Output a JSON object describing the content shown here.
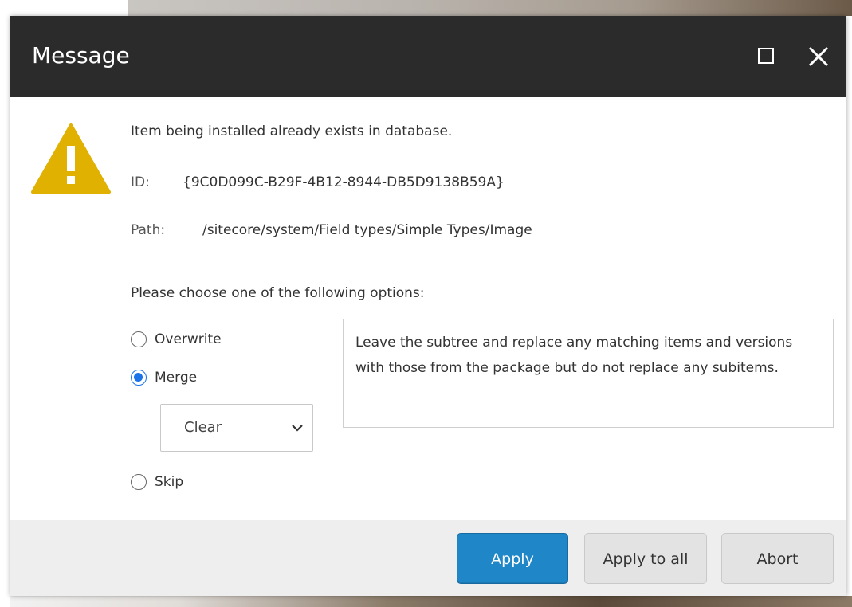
{
  "dialog": {
    "title": "Message",
    "maximize_icon": "maximize-icon",
    "close_icon": "close-icon"
  },
  "content": {
    "warning_icon": "warning-triangle-icon",
    "message": "Item being installed already exists in database.",
    "id_label": "ID:",
    "id_value": "{9C0D099C-B29F-4B12-8944-DB5D9138B59A}",
    "path_label": "Path:",
    "path_value": "/sitecore/system/Field types/Simple Types/Image",
    "prompt": "Please choose one of the following options:"
  },
  "options": {
    "overwrite": "Overwrite",
    "merge": "Merge",
    "skip": "Skip",
    "selected": "Merge",
    "merge_mode": "Clear",
    "description": "Leave the subtree and replace any matching items and versions with those from the package but do not replace any subitems."
  },
  "buttons": {
    "apply": "Apply",
    "apply_all": "Apply to all",
    "abort": "Abort"
  },
  "colors": {
    "titlebar": "#2b2b2b",
    "primary": "#1f86c7",
    "warning": "#e0b100",
    "radio_checked": "#1a73e8"
  }
}
